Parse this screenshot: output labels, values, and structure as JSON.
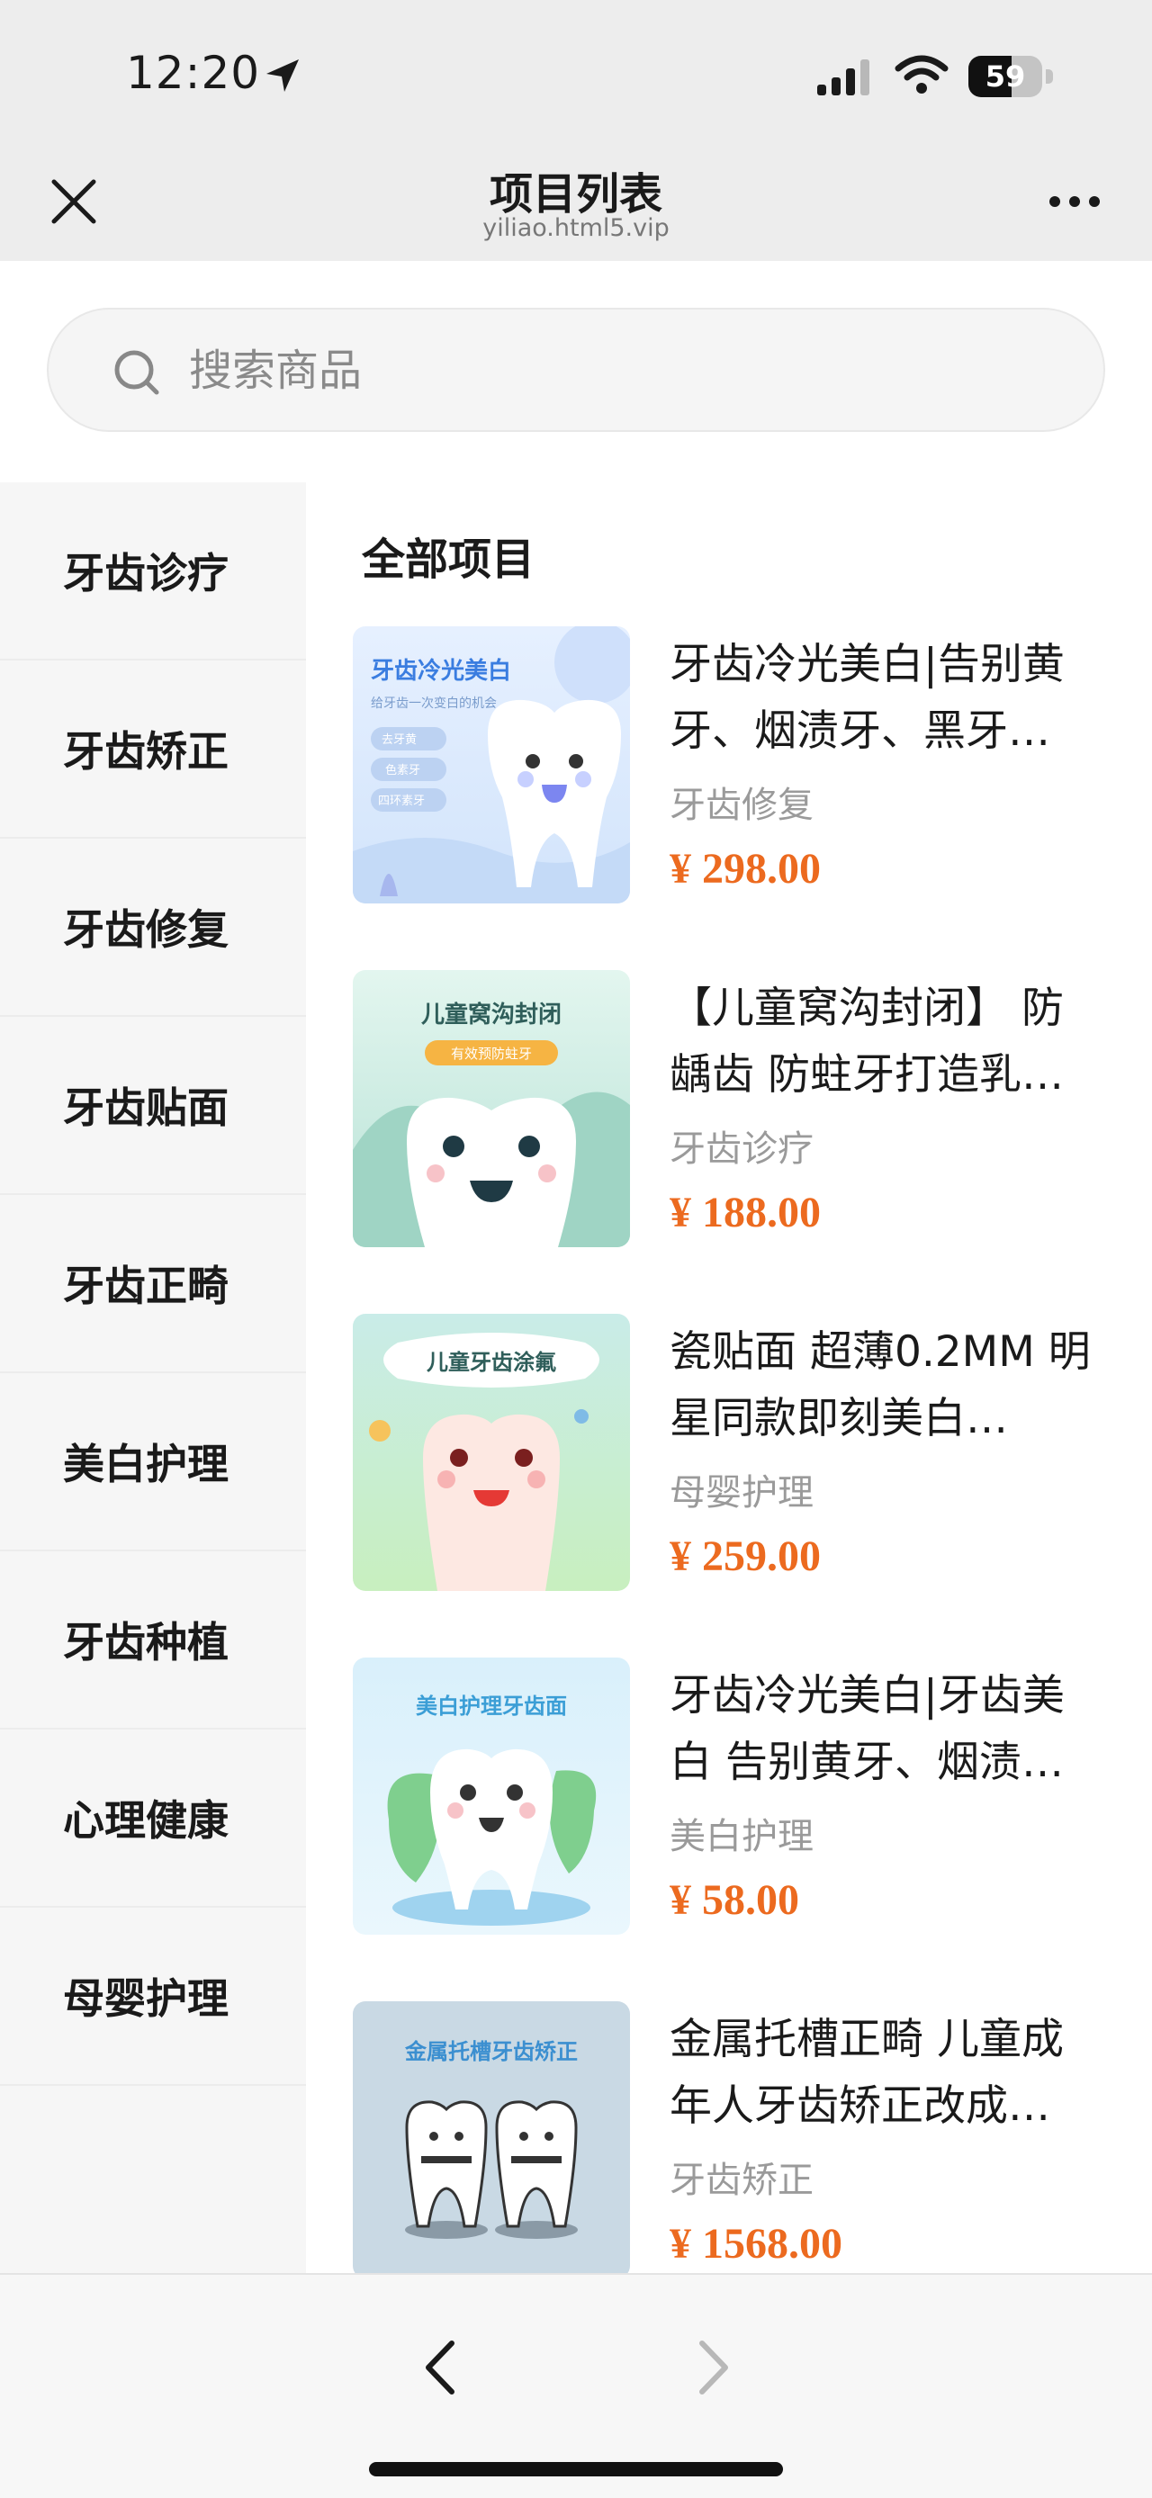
{
  "status": {
    "time": "12:20",
    "battery": "59",
    "battery_level": 59
  },
  "nav": {
    "title": "项目列表",
    "subtitle": "yiliao.html5.vip"
  },
  "search": {
    "placeholder": "搜索商品",
    "value": ""
  },
  "sidebar": {
    "items": [
      {
        "label": "牙齿诊疗"
      },
      {
        "label": "牙齿矫正"
      },
      {
        "label": "牙齿修复"
      },
      {
        "label": "牙齿贴面"
      },
      {
        "label": "牙齿正畸"
      },
      {
        "label": "美白护理"
      },
      {
        "label": "牙齿种植"
      },
      {
        "label": "心理健康"
      },
      {
        "label": "母婴护理"
      }
    ]
  },
  "main": {
    "section_title": "全部项目",
    "items": [
      {
        "title": "牙齿冷光美白|告别黄牙、烟渍牙、黑牙…",
        "category": "牙齿修复",
        "price": "¥ 298.00",
        "thumb": {
          "title": "牙齿冷光美白",
          "subtitle": "给牙齿一次变白的机会",
          "tags": [
            "去牙黄",
            "色素牙",
            "四环素牙"
          ]
        }
      },
      {
        "title": "【儿童窝沟封闭】 防龋齿 防蛀牙打造乳…",
        "category": "牙齿诊疗",
        "price": "¥ 188.00",
        "thumb": {
          "title": "儿童窝沟封闭",
          "badge": "有效预防蛀牙"
        }
      },
      {
        "title": "瓷贴面 超薄0.2MM 明星同款即刻美白…",
        "category": "母婴护理",
        "price": "¥ 259.00",
        "thumb": {
          "title": "儿童牙齿涂氟"
        }
      },
      {
        "title": "牙齿冷光美白|牙齿美白 告别黄牙、烟渍…",
        "category": "美白护理",
        "price": "¥ 58.00",
        "thumb": {
          "title": "美白护理牙齿面"
        }
      },
      {
        "title": "金属托槽正畸 儿童成年人牙齿矫正改成…",
        "category": "牙齿矫正",
        "price": "¥ 1568.00",
        "thumb": {
          "title": "金属托槽牙齿矫正"
        }
      }
    ]
  },
  "colors": {
    "price": "#ec6a1f",
    "sidebar_bg": "#f6f6f6",
    "nav_bg": "#ededed"
  }
}
